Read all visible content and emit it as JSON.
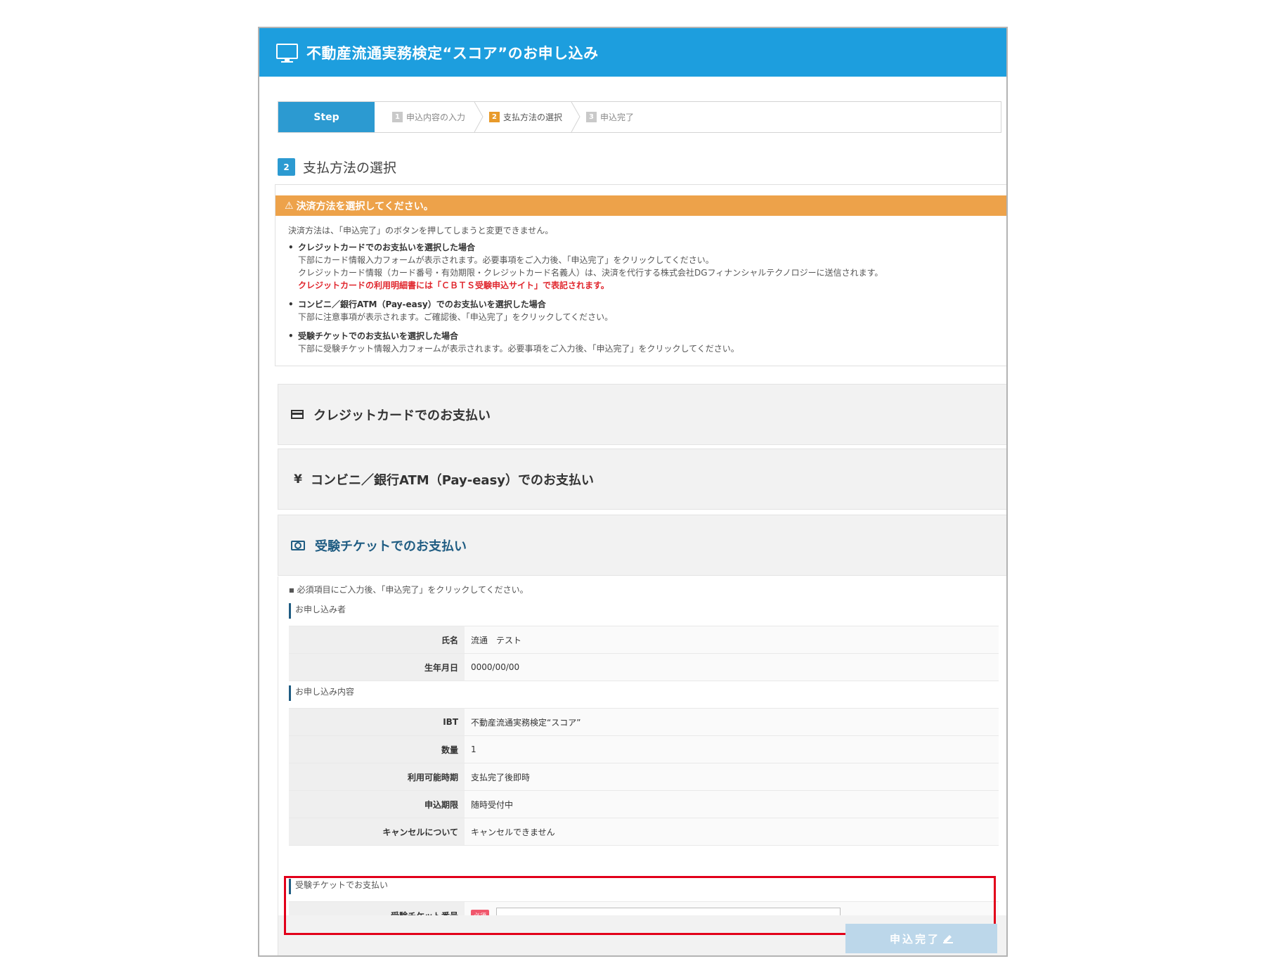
{
  "header": {
    "title": "不動産流通実務検定“スコア”のお申し込み",
    "icon": "monitor-icon"
  },
  "steps": {
    "label": "Step",
    "items": [
      {
        "num": "1",
        "label": "申込内容の入力",
        "active": false
      },
      {
        "num": "2",
        "label": "支払方法の選択",
        "active": true
      },
      {
        "num": "3",
        "label": "申込完了",
        "active": false
      }
    ]
  },
  "section": {
    "num": "2",
    "title": "支払方法の選択"
  },
  "notice": {
    "warning": "決済方法を選択してください。",
    "intro": "決済方法は、「申込完了」のボタンを押してしまうと変更できません。",
    "credit_head": "クレジットカードでのお支払いを選択した場合",
    "credit_line1": "下部にカード情報入力フォームが表示されます。必要事項をご入力後、「申込完了」をクリックしてください。",
    "credit_line2": "クレジットカード情報（カード番号・有効期限・クレジットカード名義人）は、決済を代行する株式会社DGフィナンシャルテクノロジーに送信されます。",
    "credit_red": "クレジットカードの利用明細書には「ＣＢＴＳ受験申込サイト」で表記されます。",
    "conv_head": "コンビニ／銀行ATM（Pay-easy）でのお支払いを選択した場合",
    "conv_line1": "下部に注意事項が表示されます。ご確認後、「申込完了」をクリックしてください。",
    "ticket_head": "受験チケットでのお支払いを選択した場合",
    "ticket_line1": "下部に受験チケット情報入力フォームが表示されます。必要事項をご入力後、「申込完了」をクリックしてください。"
  },
  "payment_options": {
    "credit": "クレジットカードでのお支払い",
    "conv_symbol": "¥",
    "conv": "コンビニ／銀行ATM（Pay-easy）でのお支払い",
    "ticket": "受験チケットでのお支払い"
  },
  "ticket_form": {
    "instruction": "必須項目にご入力後、「申込完了」をクリックしてください。",
    "applicant_head": "お申し込み者",
    "applicant": [
      {
        "key": "氏名",
        "value": "流通　テスト"
      },
      {
        "key": "生年月日",
        "value": "0000/00/00"
      }
    ],
    "content_head": "お申し込み内容",
    "content": [
      {
        "key": "IBT",
        "value": "不動産流通実務検定“スコア”"
      },
      {
        "key": "数量",
        "value": "1"
      },
      {
        "key": "利用可能時期",
        "value": "支払完了後即時"
      },
      {
        "key": "申込期限",
        "value": "随時受付中"
      },
      {
        "key": "キャンセルについて",
        "value": "キャンセルできません"
      }
    ],
    "ticket_head": "受験チケットでお支払い",
    "ticket_label": "受験チケット番号",
    "required": "必須",
    "ticket_value": ""
  },
  "submit_label": "申込完了",
  "colors": {
    "header": "#1d9ede",
    "warning": "#eda24a",
    "highlight": "#e2001a",
    "accent": "#2c9ad1"
  }
}
